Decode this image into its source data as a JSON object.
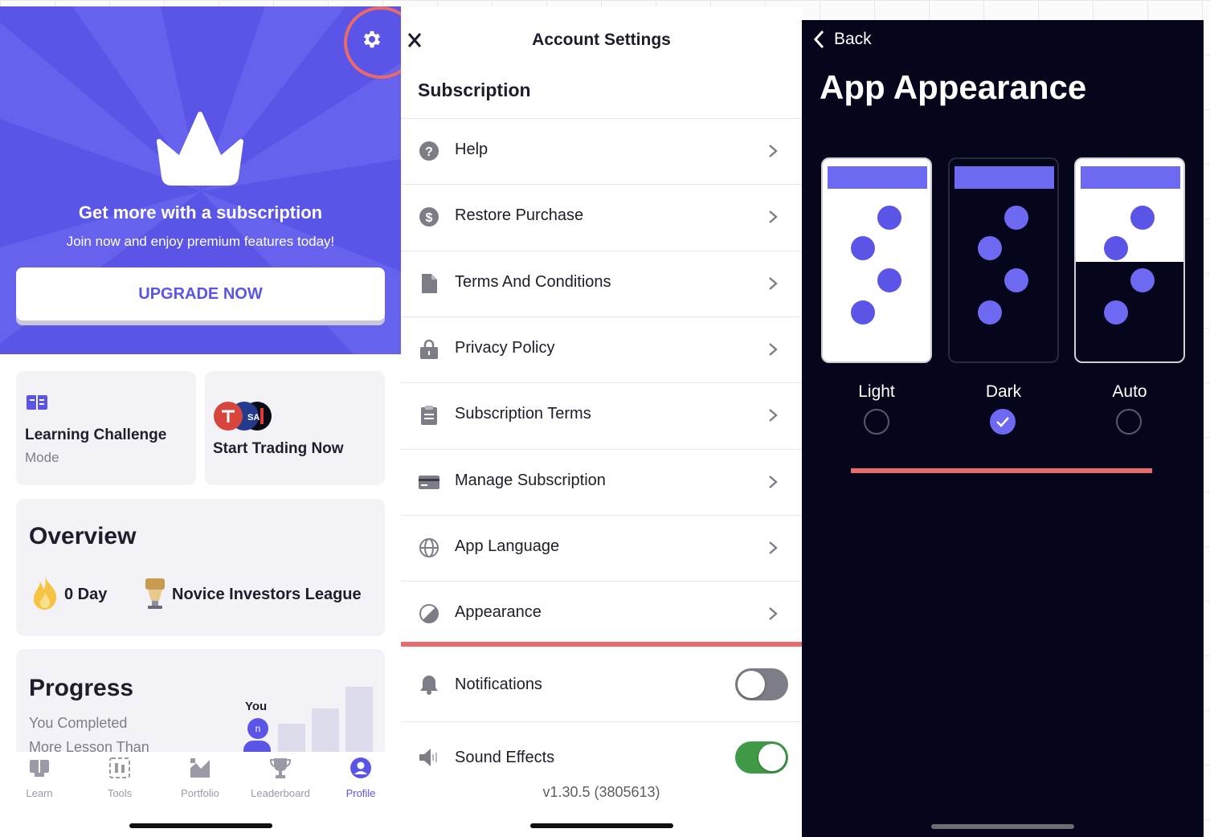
{
  "profile": {
    "hero_title": "Get more with a subscription",
    "hero_subtitle": "Join now and enjoy premium features today!",
    "upgrade_label": "UPGRADE NOW",
    "learning_challenge_title": "Learning Challenge",
    "learning_challenge_sub": "Mode",
    "start_trading_title": "Start Trading Now",
    "logo_badge_text": "SA",
    "overview_title": "Overview",
    "streak": "0 Day",
    "league": "Novice Investors League",
    "progress_title": "Progress",
    "progress_text_line1": "You Completed",
    "progress_text_line2": "More Lesson Than",
    "you_label": "You",
    "avatar_initial": "n",
    "tabs": [
      {
        "label": "Learn",
        "icon": "learn-icon"
      },
      {
        "label": "Tools",
        "icon": "tools-icon"
      },
      {
        "label": "Portfolio",
        "icon": "portfolio-icon"
      },
      {
        "label": "Leaderboard",
        "icon": "trophy-icon"
      },
      {
        "label": "Profile",
        "icon": "profile-icon",
        "active": true
      }
    ],
    "accent_color": "#5a55e6"
  },
  "account_settings": {
    "title": "Account Settings",
    "section": "Subscription",
    "items": [
      {
        "label": "Help",
        "icon": "help-icon"
      },
      {
        "label": "Restore Purchase",
        "icon": "dollar-icon"
      },
      {
        "label": "Terms And Conditions",
        "icon": "document-icon"
      },
      {
        "label": "Privacy Policy",
        "icon": "lock-icon"
      },
      {
        "label": "Subscription Terms",
        "icon": "clipboard-icon"
      },
      {
        "label": "Manage Subscription",
        "icon": "card-icon"
      },
      {
        "label": "App Language",
        "icon": "globe-icon"
      },
      {
        "label": "Appearance",
        "icon": "appearance-icon"
      }
    ],
    "notifications": {
      "label": "Notifications",
      "icon": "bell-icon",
      "enabled": false
    },
    "sound_effects": {
      "label": "Sound Effects",
      "icon": "speaker-icon",
      "enabled": true
    },
    "version": "v1.30.5 (3805613)",
    "toggle_on_color": "#3f9a46"
  },
  "app_appearance": {
    "back_label": "Back",
    "title": "App Appearance",
    "options": [
      {
        "label": "Light",
        "selected": false
      },
      {
        "label": "Dark",
        "selected": true
      },
      {
        "label": "Auto",
        "selected": false
      }
    ],
    "highlight_color": "#e86a6a"
  }
}
